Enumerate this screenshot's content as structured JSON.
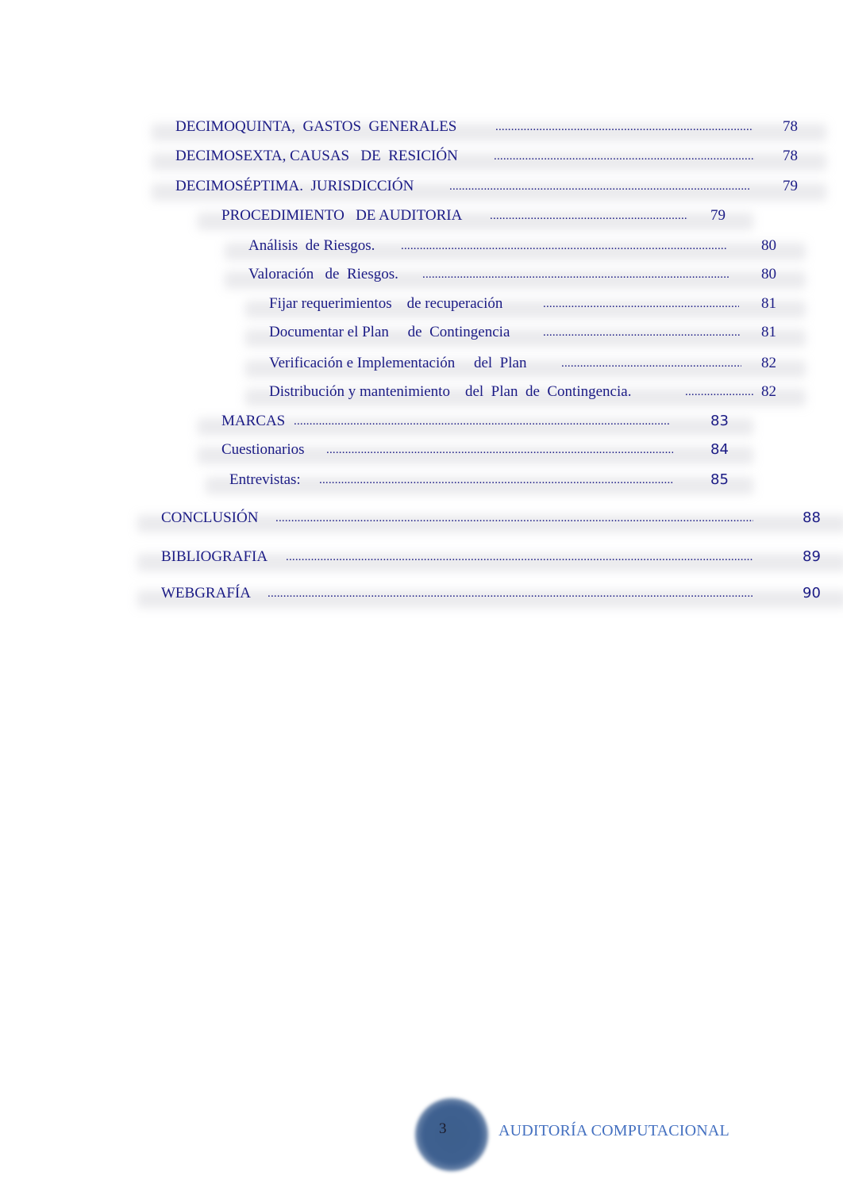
{
  "toc": {
    "entries": [
      {
        "title": "DECIMOQUINTA,  GASTOS  GENERALES ",
        "page": "78"
      },
      {
        "title": "DECIMOSEXTA, CAUSAS   DE  RESICIÓN ",
        "page": "78"
      },
      {
        "title": "DECIMOSÉPTIMA.  JURISDICCIÓN ",
        "page": "79"
      },
      {
        "title": "PROCEDIMIENTO   DE AUDITORIA",
        "page": "79"
      },
      {
        "title": "Análisis  de Riesgos.   ",
        "page": "80"
      },
      {
        "title": "Valoración   de  Riesgos.  ",
        "page": "80"
      },
      {
        "title": "Fijar requerimientos    de recuperación    ",
        "page": "81"
      },
      {
        "title": "Documentar el Plan     de  Contingencia  ",
        "page": "81"
      },
      {
        "title": "Verificación e Implementación     del  Plan ",
        "page": "82"
      },
      {
        "title": "Distribución y mantenimiento    del  Plan  de  Contingencia.  ",
        "page": "82"
      },
      {
        "title": "MARCAS",
        "page": "83"
      },
      {
        "title": "Cuestionarios   ",
        "page": "84"
      },
      {
        "title": "Entrevistas:  ",
        "page": "85"
      },
      {
        "title": "CONCLUSIÓN ",
        "page": "88"
      },
      {
        "title": "BIBLIOGRAFIA ",
        "page": "89"
      },
      {
        "title": "WEBGRAFÍA ",
        "page": "90"
      }
    ],
    "leader_char": "."
  },
  "footer": {
    "page_number": "3",
    "document_title": "AUDITORÍA COMPUTACIONAL"
  },
  "colors": {
    "toc_text": "#1b1b85",
    "footer_title": "#4470c0",
    "footer_circle": "#3e6090"
  }
}
